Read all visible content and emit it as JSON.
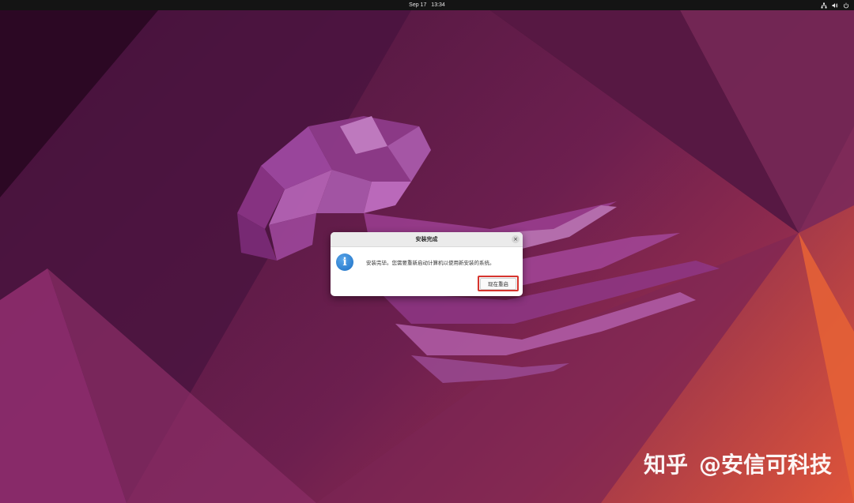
{
  "topbar": {
    "date": "Sep 17",
    "time": "13:34",
    "icons": [
      "network-icon",
      "volume-icon",
      "power-icon"
    ]
  },
  "dialog": {
    "title": "安装完成",
    "close_label": "×",
    "icon": "info-icon",
    "icon_glyph": "i",
    "message": "安装完毕。您需要重新启动计算机以使用新安装的系统。",
    "restart_button_label": "现在重启",
    "highlight_color": "#d6342d"
  },
  "watermark": {
    "logo": "知乎",
    "handle": "@安信可科技"
  }
}
